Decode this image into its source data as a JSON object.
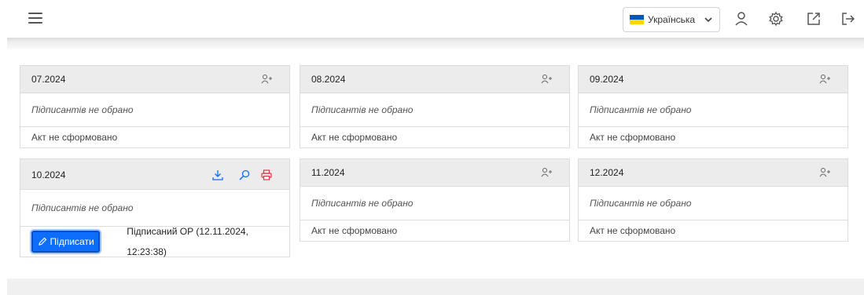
{
  "header": {
    "language": "Українська"
  },
  "cards": [
    {
      "period": "07.2024",
      "signers": "Підписантів не обрано",
      "status": "Акт не сформовано"
    },
    {
      "period": "08.2024",
      "signers": "Підписантів не обрано",
      "status": "Акт не сформовано"
    },
    {
      "period": "09.2024",
      "signers": "Підписантів не обрано",
      "status": "Акт не сформовано"
    },
    {
      "period": "10.2024",
      "signers": "Підписантів не обрано",
      "sign_button": "Підписати",
      "signed_status": "Підписаний ОР (12.11.2024, 12:23:38)"
    },
    {
      "period": "11.2024",
      "signers": "Підписантів не обрано",
      "status": "Акт не сформовано"
    },
    {
      "period": "12.2024",
      "signers": "Підписантів не обрано",
      "status": "Акт не сформовано"
    }
  ],
  "icons": {
    "menu": "hamburger-icon",
    "profile": "user-icon",
    "settings": "gear-icon",
    "external": "external-link-icon",
    "logout": "logout-icon",
    "add_signer": "add-user-icon",
    "download": "download-icon",
    "view": "search-icon",
    "print": "printer-icon"
  },
  "colors": {
    "primary": "#0d6efd",
    "download": "#0d6efd",
    "print": "#dc3545"
  }
}
